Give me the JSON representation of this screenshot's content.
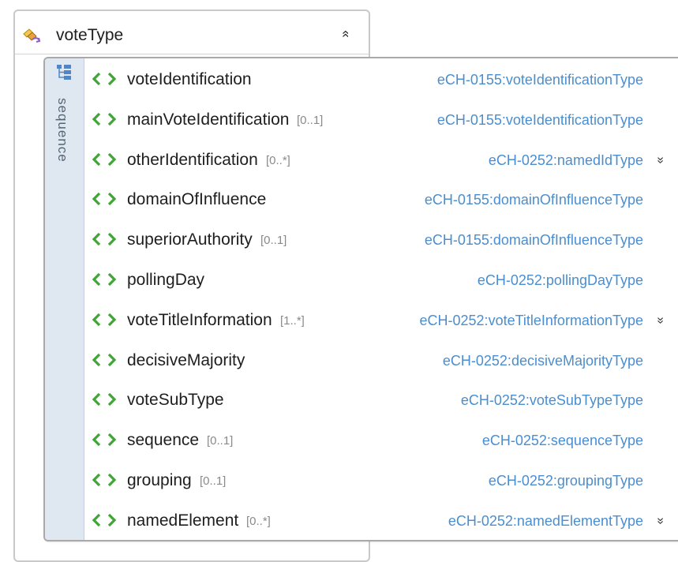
{
  "complex_type": {
    "name": "voteType",
    "icon": "complex-type-icon",
    "collapse_glyph": "«"
  },
  "compositor": {
    "label": "sequence",
    "icon": "sequence-icon"
  },
  "elements": [
    {
      "name": "voteIdentification",
      "cardinality": "",
      "type": "eCH-0155:voteIdentificationType",
      "expandable": false
    },
    {
      "name": "mainVoteIdentification",
      "cardinality": "[0..1]",
      "type": "eCH-0155:voteIdentificationType",
      "expandable": false
    },
    {
      "name": "otherIdentification",
      "cardinality": "[0..*]",
      "type": "eCH-0252:namedIdType",
      "expandable": true
    },
    {
      "name": "domainOfInfluence",
      "cardinality": "",
      "type": "eCH-0155:domainOfInfluenceType",
      "expandable": false
    },
    {
      "name": "superiorAuthority",
      "cardinality": "[0..1]",
      "type": "eCH-0155:domainOfInfluenceType",
      "expandable": false
    },
    {
      "name": "pollingDay",
      "cardinality": "",
      "type": "eCH-0252:pollingDayType",
      "expandable": false
    },
    {
      "name": "voteTitleInformation",
      "cardinality": "[1..*]",
      "type": "eCH-0252:voteTitleInformationType",
      "expandable": true
    },
    {
      "name": "decisiveMajority",
      "cardinality": "",
      "type": "eCH-0252:decisiveMajorityType",
      "expandable": false
    },
    {
      "name": "voteSubType",
      "cardinality": "",
      "type": "eCH-0252:voteSubTypeType",
      "expandable": false
    },
    {
      "name": "sequence",
      "cardinality": "[0..1]",
      "type": "eCH-0252:sequenceType",
      "expandable": false
    },
    {
      "name": "grouping",
      "cardinality": "[0..1]",
      "type": "eCH-0252:groupingType",
      "expandable": false
    },
    {
      "name": "namedElement",
      "cardinality": "[0..*]",
      "type": "eCH-0252:namedElementType",
      "expandable": true
    }
  ],
  "colors": {
    "element_icon": "#3fa535",
    "type_text": "#4a8ed0",
    "strip_bg": "#dfe7f1"
  }
}
